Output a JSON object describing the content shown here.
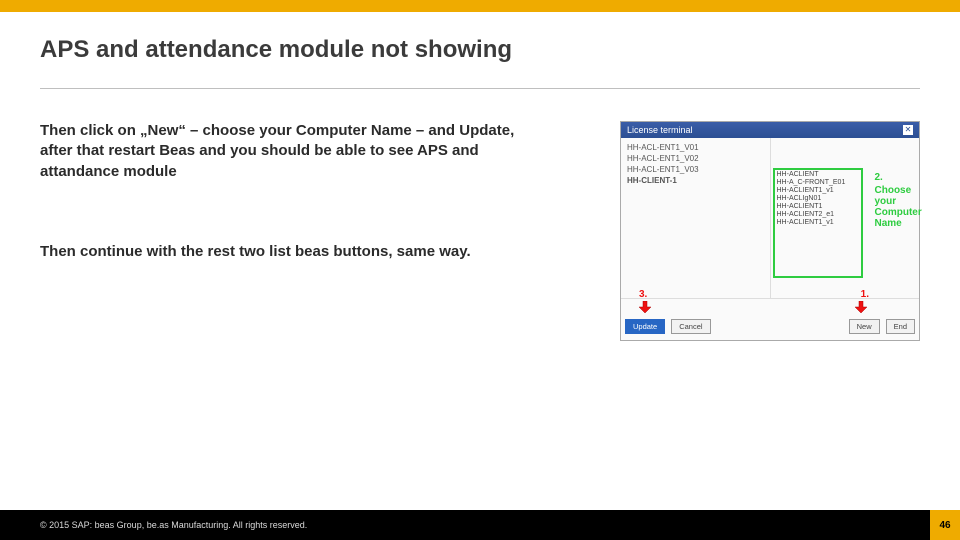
{
  "title": "APS and attendance module not showing",
  "body": {
    "para1": "Then click on „New“ – choose your Computer Name – and Update, after that restart Beas and you should be able to see APS and attandance module",
    "para2": "Then continue with the rest two list beas buttons, same way."
  },
  "screenshot": {
    "window_title": "License terminal",
    "left_list": [
      "HH-ACL-ENT1_V01",
      "HH-ACL-ENT1_V02",
      "HH-ACL-ENT1_V03",
      "HH-CLIENT-1"
    ],
    "right_list": [
      "HH-ACLIENT",
      "HH-A_C-FRONT_E01",
      "HH-ACLIENT1_v1",
      "HH-ACLIgN01",
      "HH-ACLIENT1",
      "HH-ACLIENT2_e1",
      "HH-ACLIENT1_v1"
    ],
    "step2_num": "2.",
    "step2_text": "Choose your Computer Name",
    "step3_num": "3.",
    "step1_num": "1.",
    "buttons": {
      "update": "Update",
      "cancel": "Cancel",
      "new": "New",
      "end": "End"
    }
  },
  "footer": {
    "copyright": "© 2015 SAP: beas Group, be.as Manufacturing. All rights reserved.",
    "page": "46"
  }
}
